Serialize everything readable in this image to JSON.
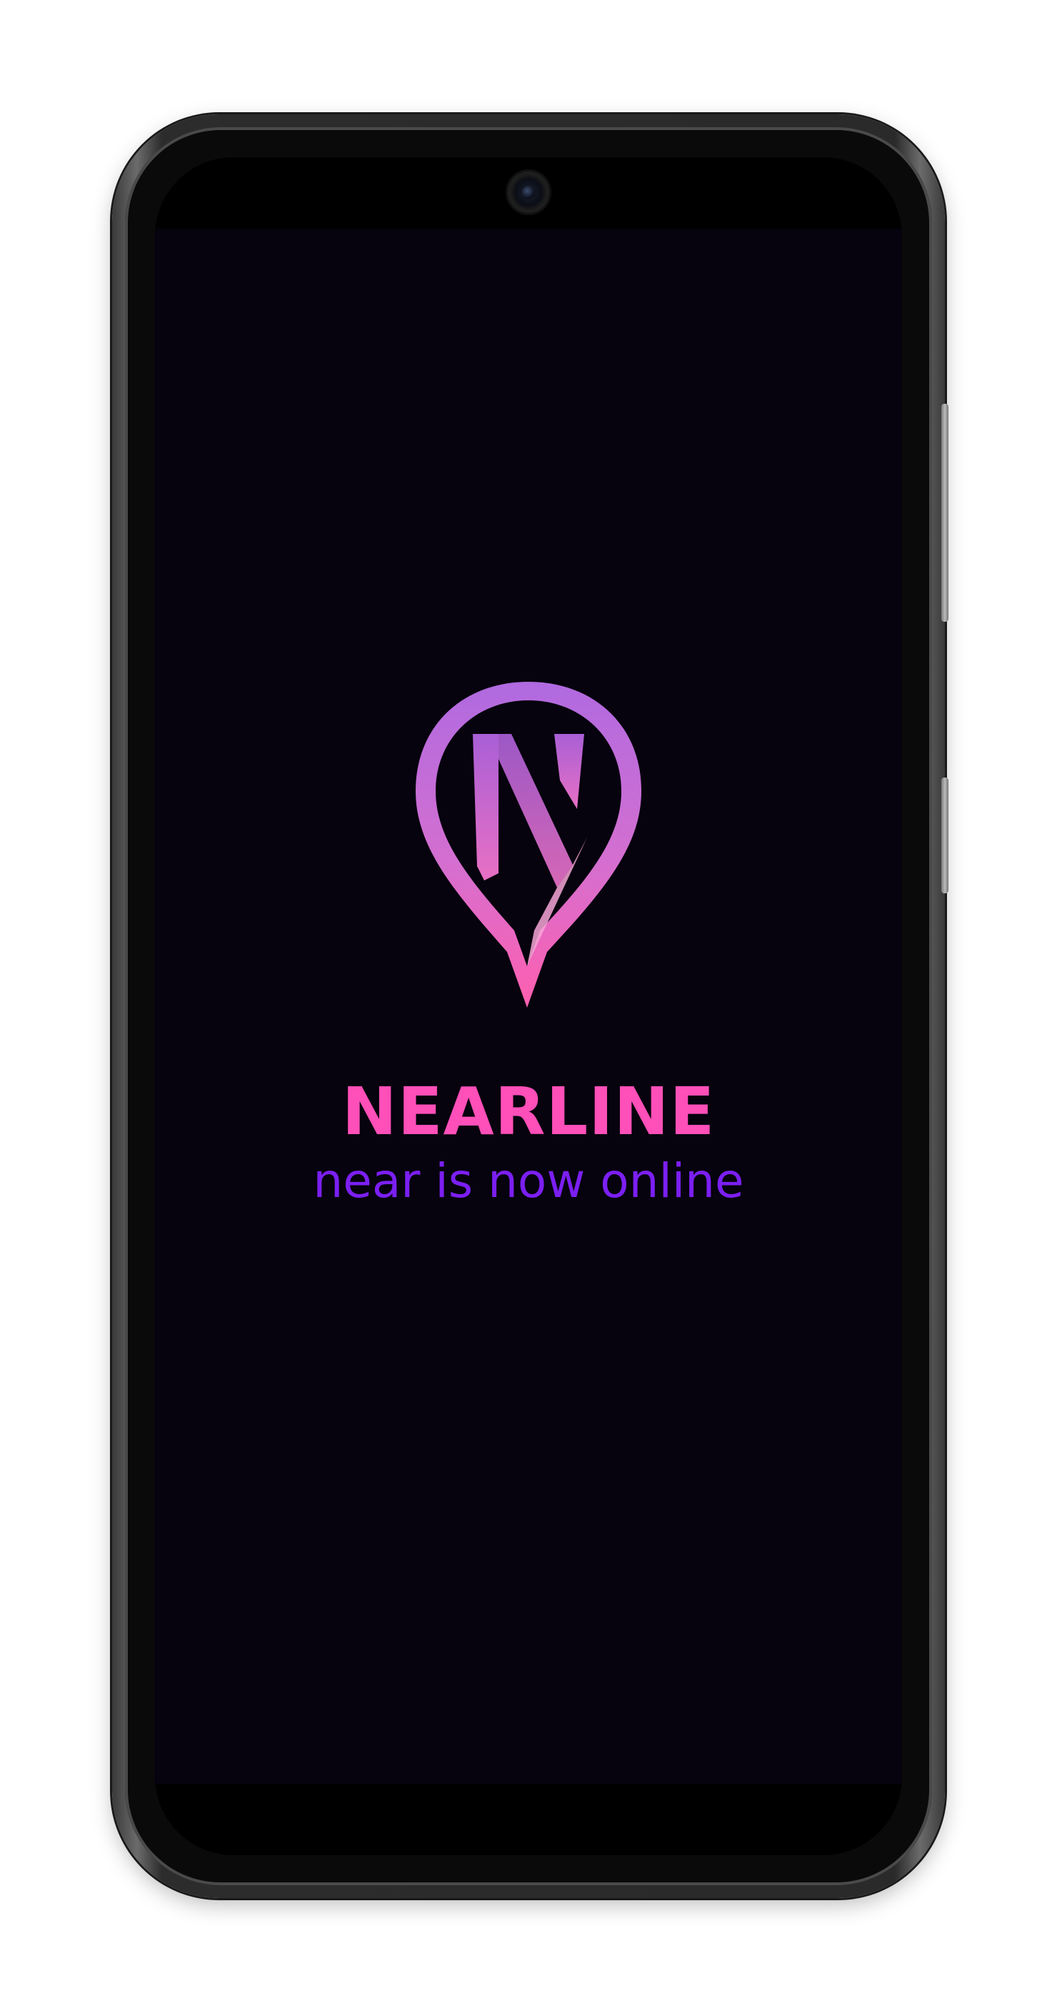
{
  "app": {
    "brand_name": "NEARLINE",
    "tagline": "near is now online"
  },
  "logo": {
    "icon": "location-pin-n-logo",
    "letter": "N"
  },
  "colors": {
    "background": "#06020e",
    "brand_pink": "#ff4fb8",
    "tagline_purple": "#7b1ff2",
    "logo_gradient_top": "#b36be0",
    "logo_gradient_bottom": "#ff5fb0"
  }
}
